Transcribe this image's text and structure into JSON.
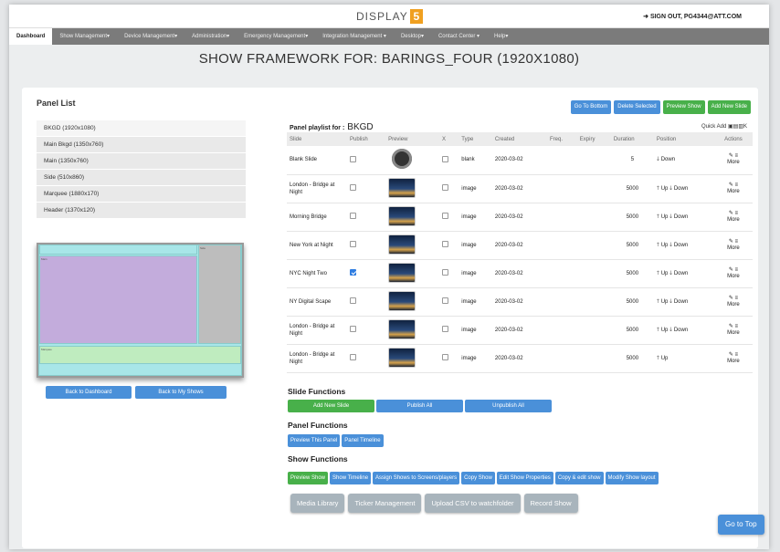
{
  "header": {
    "logo_text": "DISPLAY",
    "logo_mark": "5",
    "signout": "SIGN OUT, PG4344@ATT.COM"
  },
  "nav": [
    "Dashboard",
    "Show Management",
    "Device Management",
    "Administration",
    "Emergency Management",
    "Integration Management",
    "Desktop",
    "Contact Center",
    "Help"
  ],
  "title": "SHOW FRAMEWORK FOR: BARINGS_FOUR (1920X1080)",
  "panel_list": {
    "title": "Panel List",
    "items": [
      "BKGD  (1920x1080)",
      "Main Bkgd  (1350x760)",
      "Main  (1350x760)",
      "Side  (510x860)",
      "Marquee  (1880x170)",
      "Header  (1370x120)"
    ]
  },
  "layout_zones": [
    "Main",
    "Side",
    "Marquee"
  ],
  "back_buttons": {
    "dashboard": "Back to Dashboard",
    "shows": "Back to My Shows"
  },
  "top_buttons": {
    "bottom": "Go To Bottom",
    "delete": "Delete Selected",
    "preview": "Preview Show",
    "add": "Add New Slide"
  },
  "playlist": {
    "label": "Panel playlist for :",
    "panel": "BKGD",
    "quick_add": "Quick Add"
  },
  "table": {
    "headers": [
      "Slide",
      "Publish",
      "Preview",
      "X",
      "Type",
      "Created",
      "Freq.",
      "Expiry",
      "Duration",
      "Position",
      "Actions"
    ],
    "rows": [
      {
        "slide": "Blank Slide",
        "published": false,
        "type": "blank",
        "created": "2020-03-02",
        "duration": "5",
        "up": "",
        "down": "Down",
        "edit": "✎",
        "more": "More"
      },
      {
        "slide": "London - Bridge at Night",
        "published": false,
        "type": "image",
        "created": "2020-03-02",
        "duration": "5000",
        "up": "Up",
        "down": "Down",
        "edit": "✎",
        "more": "More"
      },
      {
        "slide": "Morning Bridge",
        "published": false,
        "type": "image",
        "created": "2020-03-02",
        "duration": "5000",
        "up": "Up",
        "down": "Down",
        "edit": "✎",
        "more": "More"
      },
      {
        "slide": "New York at Night",
        "published": false,
        "type": "image",
        "created": "2020-03-02",
        "duration": "5000",
        "up": "Up",
        "down": "Down",
        "edit": "✎",
        "more": "More"
      },
      {
        "slide": "NYC Night Two",
        "published": true,
        "type": "image",
        "created": "2020-03-02",
        "duration": "5000",
        "up": "Up",
        "down": "Down",
        "edit": "✎",
        "more": "More"
      },
      {
        "slide": "NY Digital Scape",
        "published": false,
        "type": "image",
        "created": "2020-03-02",
        "duration": "5000",
        "up": "Up",
        "down": "Down",
        "edit": "✎",
        "more": "More"
      },
      {
        "slide": "London - Bridge at Night",
        "published": false,
        "type": "image",
        "created": "2020-03-02",
        "duration": "5000",
        "up": "Up",
        "down": "Down",
        "edit": "✎",
        "more": "More"
      },
      {
        "slide": "London - Bridge at Night",
        "published": false,
        "type": "image",
        "created": "2020-03-02",
        "duration": "5000",
        "up": "Up",
        "down": "",
        "edit": "✎",
        "more": "More"
      }
    ]
  },
  "slide_functions": {
    "title": "Slide Functions",
    "add": "Add New Slide",
    "publish": "Publish All",
    "unpublish": "Unpublish All"
  },
  "panel_functions": {
    "title": "Panel Functions",
    "preview": "Preview This Panel",
    "timeline": "Panel Timeline"
  },
  "show_functions": {
    "title": "Show Functions",
    "buttons": [
      "Preview Show",
      "Show Timeline",
      "Assign Shows to Screens/players",
      "Copy Show",
      "Edit Show Properties",
      "Copy & edit show",
      "Modify Show layout"
    ]
  },
  "bottom_buttons": [
    "Media Library",
    "Ticker Management",
    "Upload CSV to watchfolder",
    "Record Show"
  ],
  "go_to_top": "Go to Top",
  "colors": {
    "blue": "#4a90d9",
    "green": "#48b04a",
    "gray": "#a8b4bc",
    "nav": "#7b7b7b",
    "layout_cyan": "#a8e6e8",
    "layout_purple": "#c3acdc",
    "layout_green": "#bfecbf",
    "layout_gray": "#bdbdbd"
  }
}
